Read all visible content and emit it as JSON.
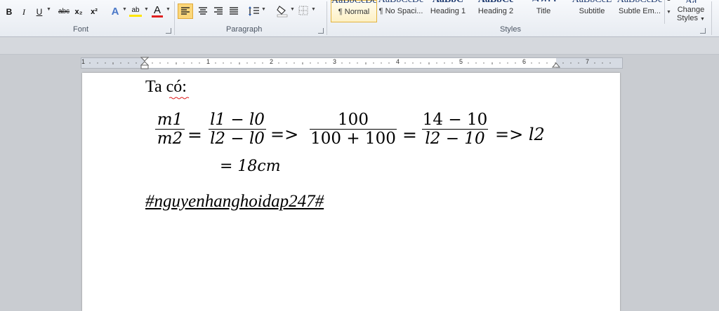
{
  "ribbon": {
    "font": {
      "group_label": "Font",
      "bold": "B",
      "italic": "I",
      "underline": "U",
      "strikethrough": "abc",
      "subscript": "x₂",
      "superscript": "x²",
      "highlight": "ab",
      "font_color": "A"
    },
    "paragraph": {
      "group_label": "Paragraph"
    },
    "styles": {
      "group_label": "Styles",
      "items": [
        "¶ Normal",
        "¶ No Spaci...",
        "Heading 1",
        "Heading 2",
        "Title",
        "Subtitle",
        "Subtle Em..."
      ],
      "change_styles_line1": "Change",
      "change_styles_line2": "Styles"
    }
  },
  "ruler": {
    "numbers": [
      "1",
      "1",
      "2",
      "3",
      "4",
      "5",
      "6",
      "7"
    ]
  },
  "document": {
    "intro": "Ta có:",
    "eq": {
      "f1_num": "m1",
      "f1_den": "m2",
      "eq1": "=",
      "f2_num": "l1 − l0",
      "f2_den": "l2 − l0",
      "arrow1": "=>",
      "f3_num": "100",
      "f3_den": "100 + 100",
      "eq2": "=",
      "f4_num": "14 − 10",
      "f4_den": "l2 − 10",
      "arrow2": "=> l2",
      "result": "= 18cm"
    },
    "hashtag": "#nguyenhanghoidap247#"
  },
  "colors": {
    "accent": "#f5c242",
    "ribbon_bg": "#eef1f6",
    "workspace": "#c9ccd1"
  }
}
